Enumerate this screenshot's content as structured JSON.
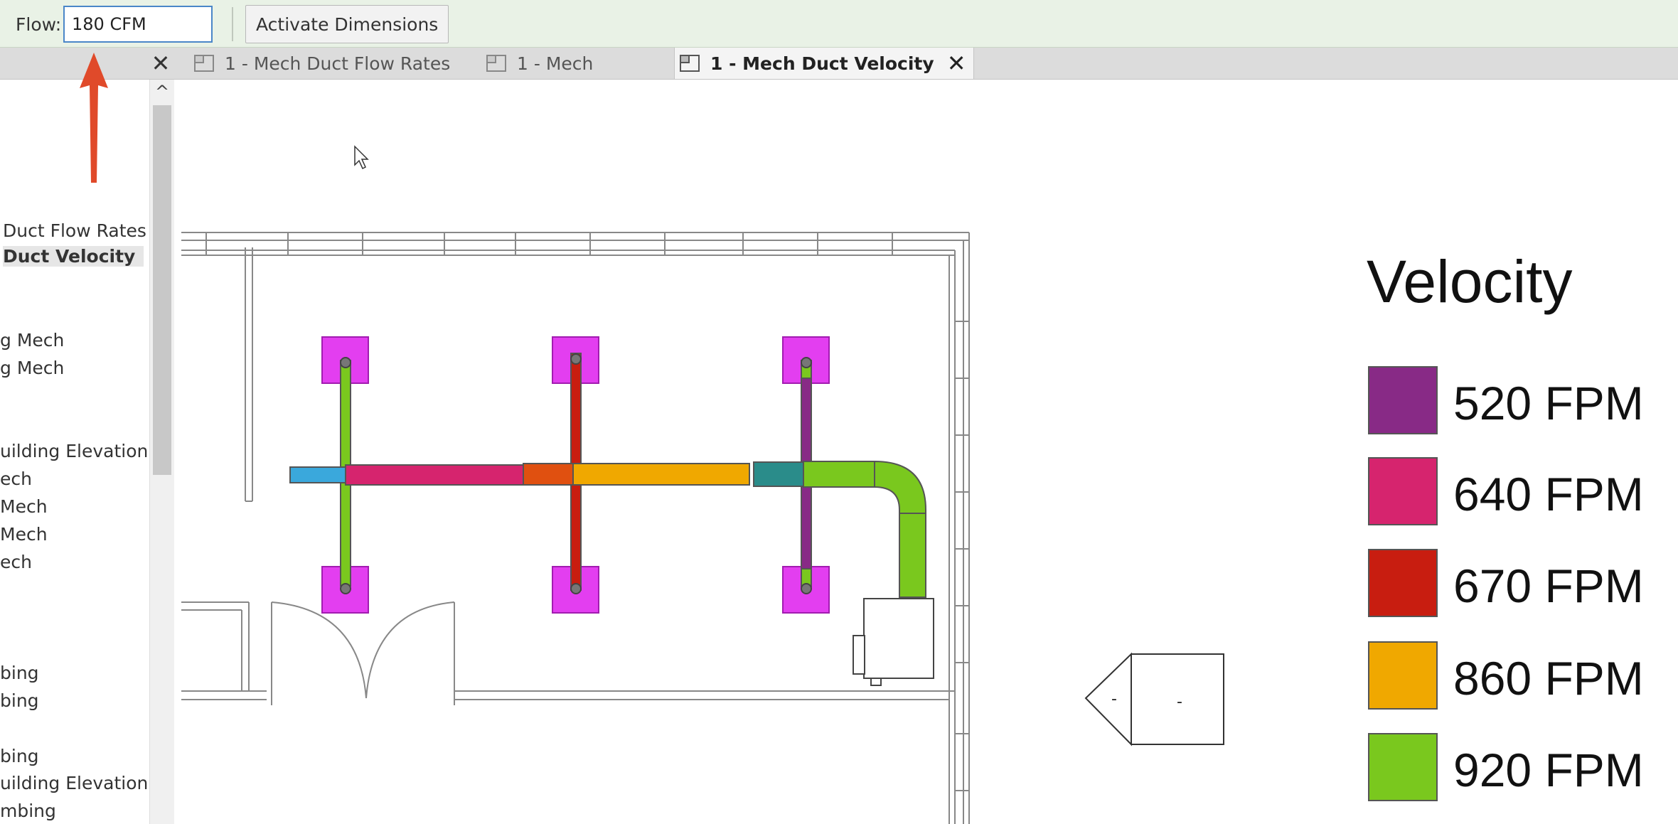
{
  "options_bar": {
    "flow_label": "Flow:",
    "flow_value": "180 CFM",
    "activate_label": "Activate Dimensions"
  },
  "tabs": [
    {
      "label": "1 - Mech Duct Flow Rates",
      "icon": "view-icon"
    },
    {
      "label": "1 - Mech",
      "icon": "view-icon"
    },
    {
      "label": "1 - Mech Duct Velocity",
      "icon": "view-icon",
      "active": true
    }
  ],
  "panel": {
    "items": [
      "Duct Flow Rates",
      "Duct Velocity",
      "g Mech",
      "g Mech",
      "uilding Elevation",
      "ech",
      "Mech",
      "Mech",
      "ech",
      "bing",
      "bing",
      "bing",
      "uilding Elevation",
      "mbing"
    ],
    "active_item": "Duct Velocity"
  },
  "legend": {
    "title": "Velocity",
    "items": [
      {
        "label": "520 FPM",
        "color": "#882a86"
      },
      {
        "label": "640 FPM",
        "color": "#d6246e"
      },
      {
        "label": "670 FPM",
        "color": "#c81d10"
      },
      {
        "label": "860 FPM",
        "color": "#f0a800"
      },
      {
        "label": "920 FPM",
        "color": "#7ac81e"
      }
    ]
  },
  "section_marker": {
    "left_text": "-",
    "right_text": "-"
  },
  "colors": {
    "diffuser": "#e33ef0",
    "duct_cyan": "#3aa8dc",
    "duct_teal": "#2a8c8a",
    "duct_orange_red": "#e05010",
    "annotation_arrow": "#e04a2a",
    "options_bar": "#e9f2e6"
  }
}
